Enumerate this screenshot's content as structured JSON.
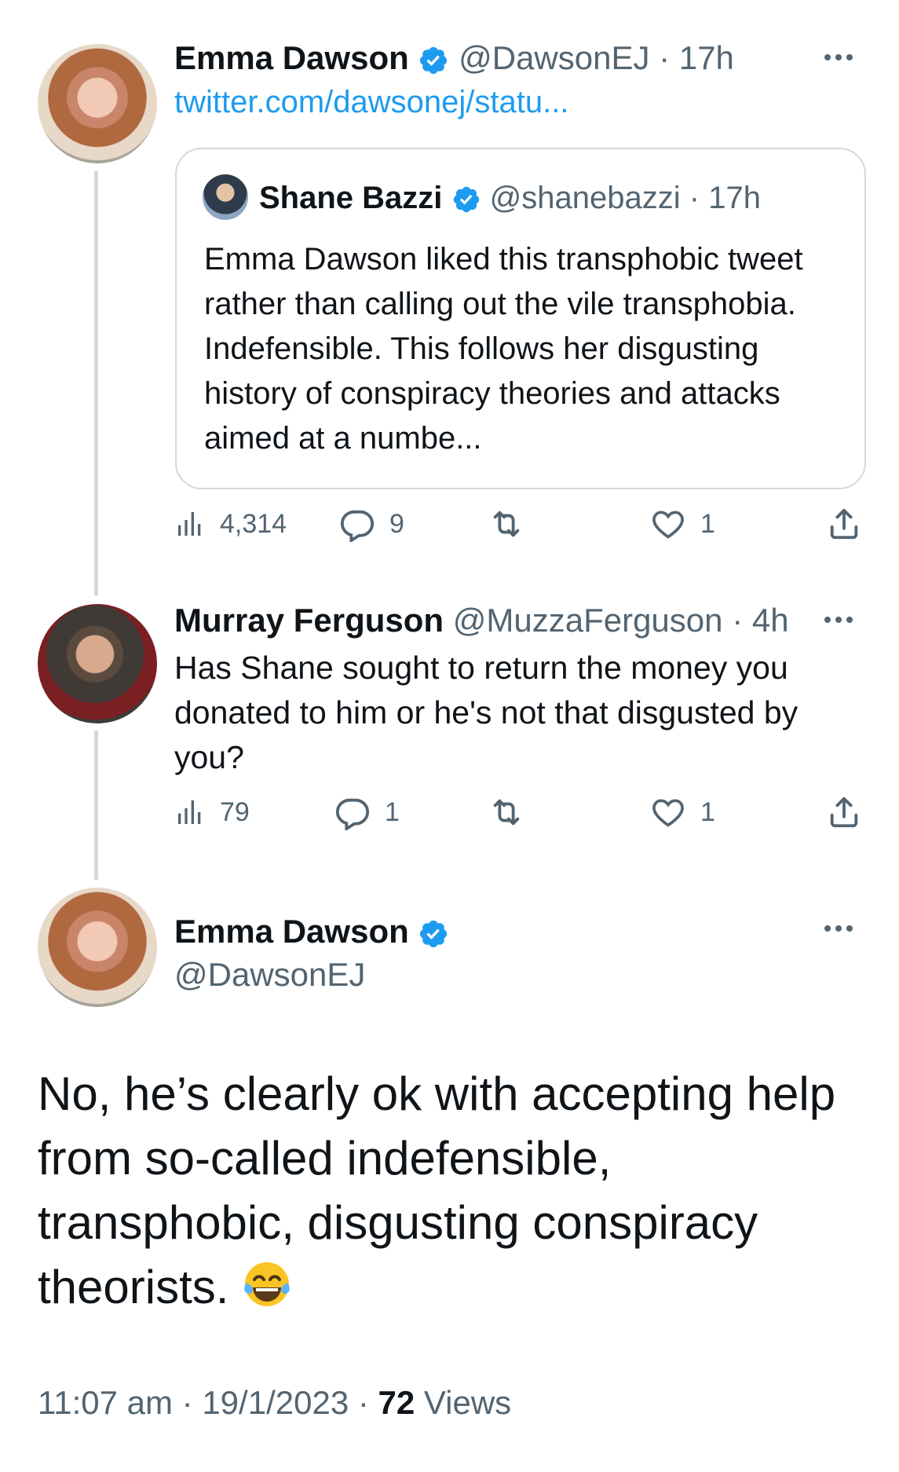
{
  "tweet1": {
    "name": "Emma Dawson",
    "handle": "@DawsonEJ",
    "time": "17h",
    "link": "twitter.com/dawsonej/statu...",
    "quote": {
      "name": "Shane Bazzi",
      "handle": "@shanebazzi",
      "time": "17h",
      "text": "Emma Dawson liked this transphobic tweet rather than calling out the vile transphobia. Indefensible. This follows her disgusting history of conspiracy theories and attacks aimed at a numbe..."
    },
    "views": "4,314",
    "replies": "9",
    "retweets": "",
    "likes": "1"
  },
  "tweet2": {
    "name": "Murray Ferguson",
    "handle": "@MuzzaFerguson",
    "time": "4h",
    "text": "Has Shane sought to return the money you donated to him or he's not that disgusted by you?",
    "views": "79",
    "replies": "1",
    "retweets": "",
    "likes": "1"
  },
  "main_tweet": {
    "name": "Emma Dawson",
    "handle": "@DawsonEJ",
    "text": "No, he’s clearly ok with accepting help from so-called indefensible, transphobic, disgusting conspiracy theorists.",
    "emoji": "face-with-tears-of-joy",
    "time": "11:07 am",
    "date": "19/1/2023",
    "views_count": "72",
    "views_label": "Views"
  },
  "icons": {
    "verified": "verified-badge-icon",
    "views": "bar-chart-icon",
    "reply": "speech-bubble-icon",
    "retweet": "retweet-icon",
    "like": "heart-icon",
    "share": "share-icon",
    "more": "more-icon"
  },
  "colors": {
    "accent": "#1d9bf0",
    "text": "#0f1419",
    "muted": "#536471",
    "border": "#cfd9de"
  }
}
